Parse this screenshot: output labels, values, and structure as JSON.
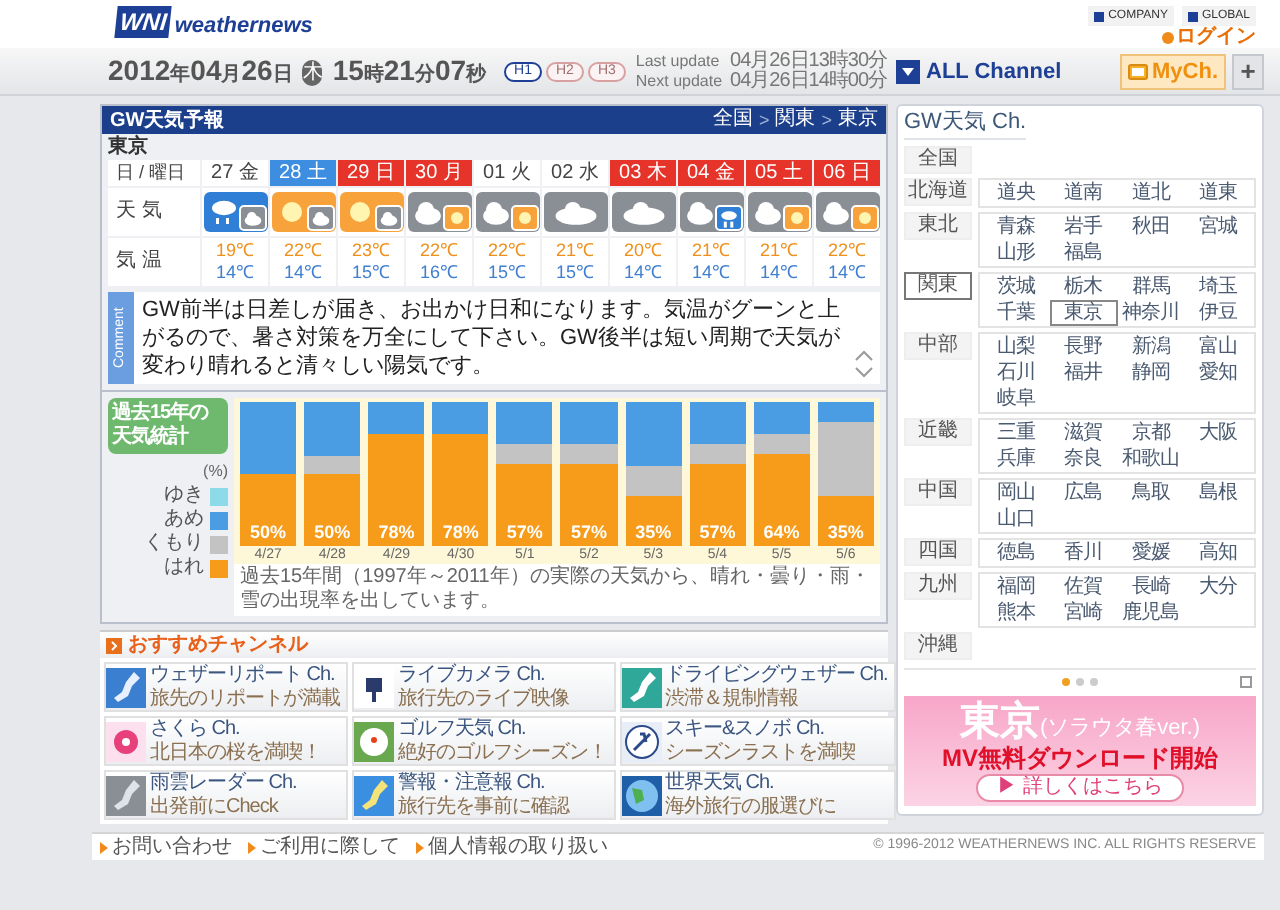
{
  "header": {
    "logo_mark": "WNI",
    "logo_text": "weathernews",
    "links": [
      {
        "label": "COMPANY"
      },
      {
        "label": "GLOBAL"
      }
    ],
    "login": "ログイン"
  },
  "datebar": {
    "date_parts": [
      {
        "text": "2012",
        "kind": "num"
      },
      {
        "text": "年",
        "kind": "unit"
      },
      {
        "text": "04",
        "kind": "num"
      },
      {
        "text": "月",
        "kind": "unit"
      },
      {
        "text": "26",
        "kind": "num"
      },
      {
        "text": "日",
        "kind": "unit"
      }
    ],
    "weekday": "木",
    "time_parts": [
      {
        "text": "15",
        "kind": "num"
      },
      {
        "text": "時",
        "kind": "unit"
      },
      {
        "text": "21",
        "kind": "num"
      },
      {
        "text": "分",
        "kind": "unit"
      },
      {
        "text": "07",
        "kind": "num"
      },
      {
        "text": "秒",
        "kind": "unit"
      }
    ],
    "modes": [
      {
        "label": "H1",
        "selected": true
      },
      {
        "label": "H2",
        "selected": false
      },
      {
        "label": "H3",
        "selected": false
      }
    ],
    "updates": [
      {
        "label": "Last update",
        "value": "04月26日13時30分"
      },
      {
        "label": "Next update",
        "value": "04月26日14時00分"
      }
    ],
    "all_channel": "ALL Channel",
    "my_channel": "MyCh.",
    "add": "+"
  },
  "forecast": {
    "title": "GW天気予報",
    "breadcrumb": [
      {
        "label": "全国",
        "kind": "link"
      },
      {
        "label": ">",
        "kind": "separator"
      },
      {
        "label": "関東",
        "kind": "link"
      },
      {
        "label": ">",
        "kind": "separator"
      },
      {
        "label": "東京",
        "kind": "link"
      }
    ],
    "city": "東京",
    "row_labels": {
      "day": "日 / 曜日",
      "weather": "天 気",
      "temp": "気 温"
    },
    "days": [
      {
        "label": "27 金",
        "kind": "weekday",
        "icon": {
          "kind": "rain_cloud"
        },
        "high": "19℃",
        "low": "14℃"
      },
      {
        "label": "28 土",
        "kind": "saturday",
        "icon": {
          "kind": "sun_cloud"
        },
        "high": "22℃",
        "low": "14℃"
      },
      {
        "label": "29 日",
        "kind": "holiday",
        "icon": {
          "kind": "sun_cloud"
        },
        "high": "23℃",
        "low": "15℃"
      },
      {
        "label": "30 月",
        "kind": "holiday",
        "icon": {
          "kind": "cloud_sun"
        },
        "high": "22℃",
        "low": "16℃"
      },
      {
        "label": "01 火",
        "kind": "weekday",
        "icon": {
          "kind": "cloud_sun"
        },
        "high": "22℃",
        "low": "15℃"
      },
      {
        "label": "02 水",
        "kind": "weekday",
        "icon": {
          "kind": "cloud"
        },
        "high": "21℃",
        "low": "15℃"
      },
      {
        "label": "03 木",
        "kind": "holiday",
        "icon": {
          "kind": "cloud"
        },
        "high": "20℃",
        "low": "14℃"
      },
      {
        "label": "04 金",
        "kind": "holiday",
        "icon": {
          "kind": "cloud_rain"
        },
        "high": "21℃",
        "low": "14℃"
      },
      {
        "label": "05 土",
        "kind": "holiday",
        "icon": {
          "kind": "cloud_sun"
        },
        "high": "21℃",
        "low": "14℃"
      },
      {
        "label": "06 日",
        "kind": "holiday",
        "icon": {
          "kind": "cloud_sun"
        },
        "high": "22℃",
        "low": "14℃"
      }
    ],
    "comment": {
      "tab": "Comment",
      "text": "GW前半は日差しが届き、お出かけ日和になります。気温がグーンと上がるので、暑さ対策を万全にして下さい。GW後半は短い周期で天気が変わり晴れると清々しい陽気です。"
    }
  },
  "statistics": {
    "title": "過去15年の天気統計",
    "unit": "(%)",
    "legend": [
      {
        "label": "ゆき",
        "color": "#8ddbe8"
      },
      {
        "label": "あめ",
        "color": "#4b9de3"
      },
      {
        "label": "くもり",
        "color": "#c3c3c3"
      },
      {
        "label": "はれ",
        "color": "#f79c1a"
      }
    ],
    "bars": [
      {
        "date": "4/27",
        "label": "50%",
        "sunny": {
          "level": 0.5
        }
      },
      {
        "date": "4/28",
        "label": "50%",
        "sunny": {
          "level": 0.5
        },
        "sunny_or_cloudy": {
          "level": 0.62
        }
      },
      {
        "date": "4/29",
        "label": "78%",
        "sunny": {
          "level": 0.78
        }
      },
      {
        "date": "4/30",
        "label": "78%",
        "sunny": {
          "level": 0.78
        }
      },
      {
        "date": "5/1",
        "label": "57%",
        "sunny": {
          "level": 0.57
        },
        "sunny_or_cloudy": {
          "level": 0.71
        }
      },
      {
        "date": "5/2",
        "label": "57%",
        "sunny": {
          "level": 0.57
        },
        "sunny_or_cloudy": {
          "level": 0.71
        }
      },
      {
        "date": "5/3",
        "label": "35%",
        "sunny": {
          "level": 0.35
        },
        "sunny_or_cloudy": {
          "level": 0.56
        }
      },
      {
        "date": "5/4",
        "label": "57%",
        "sunny": {
          "level": 0.57
        },
        "sunny_or_cloudy": {
          "level": 0.71
        }
      },
      {
        "date": "5/5",
        "label": "64%",
        "sunny": {
          "level": 0.64
        },
        "sunny_or_cloudy": {
          "level": 0.78
        }
      },
      {
        "date": "5/6",
        "label": "35%",
        "sunny": {
          "level": 0.35
        },
        "sunny_or_cloudy": {
          "level": 0.86
        }
      }
    ],
    "note": "過去15年間（1997年～2011年）の実際の天気から、晴れ・曇り・雨・雪の出現率を出しています。"
  },
  "recommended": {
    "title": "おすすめチャンネル",
    "channels": [
      {
        "title": "ウェザーリポート Ch.",
        "subtitle": "旅先のリポートが満載"
      },
      {
        "title": "ライブカメラ Ch.",
        "subtitle": "旅行先のライブ映像"
      },
      {
        "title": "ドライビングウェザー Ch.",
        "subtitle": "渋滞＆規制情報"
      },
      {
        "title": "さくら Ch.",
        "subtitle": "北日本の桜を満喫！"
      },
      {
        "title": "ゴルフ天気 Ch.",
        "subtitle": "絶好のゴルフシーズン！"
      },
      {
        "title": "スキー&スノボ Ch.",
        "subtitle": "シーズンラストを満喫"
      },
      {
        "title": "雨雲レーダー Ch.",
        "subtitle": "出発前にCheck"
      },
      {
        "title": "警報・注意報 Ch.",
        "subtitle": "旅行先を事前に確認"
      },
      {
        "title": "世界天気 Ch.",
        "subtitle": "海外旅行の服選びに"
      }
    ]
  },
  "sidebar": {
    "title": "GW天気 Ch.",
    "regions": [
      {
        "label": "全国",
        "selected": false
      },
      {
        "label": "北海道",
        "selected": false,
        "prefectures": [
          {
            "label": "道央",
            "selected": false
          },
          {
            "label": "道南",
            "selected": false
          },
          {
            "label": "道北",
            "selected": false
          },
          {
            "label": "道東",
            "selected": false
          }
        ]
      },
      {
        "label": "東北",
        "selected": false,
        "prefectures": [
          {
            "label": "青森",
            "selected": false
          },
          {
            "label": "岩手",
            "selected": false
          },
          {
            "label": "秋田",
            "selected": false
          },
          {
            "label": "宮城",
            "selected": false
          },
          {
            "label": "山形",
            "selected": false
          },
          {
            "label": "福島",
            "selected": false
          }
        ]
      },
      {
        "label": "関東",
        "selected": true,
        "prefectures": [
          {
            "label": "茨城",
            "selected": false
          },
          {
            "label": "栃木",
            "selected": false
          },
          {
            "label": "群馬",
            "selected": false
          },
          {
            "label": "埼玉",
            "selected": false
          },
          {
            "label": "千葉",
            "selected": false
          },
          {
            "label": "東京",
            "selected": true
          },
          {
            "label": "神奈川",
            "selected": false
          },
          {
            "label": "伊豆",
            "selected": false
          }
        ]
      },
      {
        "label": "中部",
        "selected": false,
        "prefectures": [
          {
            "label": "山梨",
            "selected": false
          },
          {
            "label": "長野",
            "selected": false
          },
          {
            "label": "新潟",
            "selected": false
          },
          {
            "label": "富山",
            "selected": false
          },
          {
            "label": "石川",
            "selected": false
          },
          {
            "label": "福井",
            "selected": false
          },
          {
            "label": "静岡",
            "selected": false
          },
          {
            "label": "愛知",
            "selected": false
          },
          {
            "label": "岐阜",
            "selected": false
          }
        ]
      },
      {
        "label": "近畿",
        "selected": false,
        "prefectures": [
          {
            "label": "三重",
            "selected": false
          },
          {
            "label": "滋賀",
            "selected": false
          },
          {
            "label": "京都",
            "selected": false
          },
          {
            "label": "大阪",
            "selected": false
          },
          {
            "label": "兵庫",
            "selected": false
          },
          {
            "label": "奈良",
            "selected": false
          },
          {
            "label": "和歌山",
            "selected": false
          }
        ]
      },
      {
        "label": "中国",
        "selected": false,
        "prefectures": [
          {
            "label": "岡山",
            "selected": false
          },
          {
            "label": "広島",
            "selected": false
          },
          {
            "label": "鳥取",
            "selected": false
          },
          {
            "label": "島根",
            "selected": false
          },
          {
            "label": "山口",
            "selected": false
          }
        ]
      },
      {
        "label": "四国",
        "selected": false,
        "prefectures": [
          {
            "label": "徳島",
            "selected": false
          },
          {
            "label": "香川",
            "selected": false
          },
          {
            "label": "愛媛",
            "selected": false
          },
          {
            "label": "高知",
            "selected": false
          }
        ]
      },
      {
        "label": "九州",
        "selected": false,
        "prefectures": [
          {
            "label": "福岡",
            "selected": false
          },
          {
            "label": "佐賀",
            "selected": false
          },
          {
            "label": "長崎",
            "selected": false
          },
          {
            "label": "大分",
            "selected": false
          },
          {
            "label": "熊本",
            "selected": false
          },
          {
            "label": "宮崎",
            "selected": false
          },
          {
            "label": "鹿児島",
            "selected": false
          }
        ]
      },
      {
        "label": "沖縄",
        "selected": false
      }
    ],
    "carousel": [
      {
        "selected": true
      },
      {
        "selected": false
      },
      {
        "selected": false
      }
    ],
    "banner": {
      "title": "東京",
      "subtitle": "(ソラウタ春ver.)",
      "headline": "MV無料ダウンロード開始",
      "button": "▶ 詳しくはこちら"
    }
  },
  "footer": {
    "links": [
      "お問い合わせ",
      "ご利用に際して",
      "個人情報の取り扱い"
    ],
    "copyright": "© 1996-2012 WEATHERNEWS INC. ALL RIGHTS RESERVE"
  }
}
